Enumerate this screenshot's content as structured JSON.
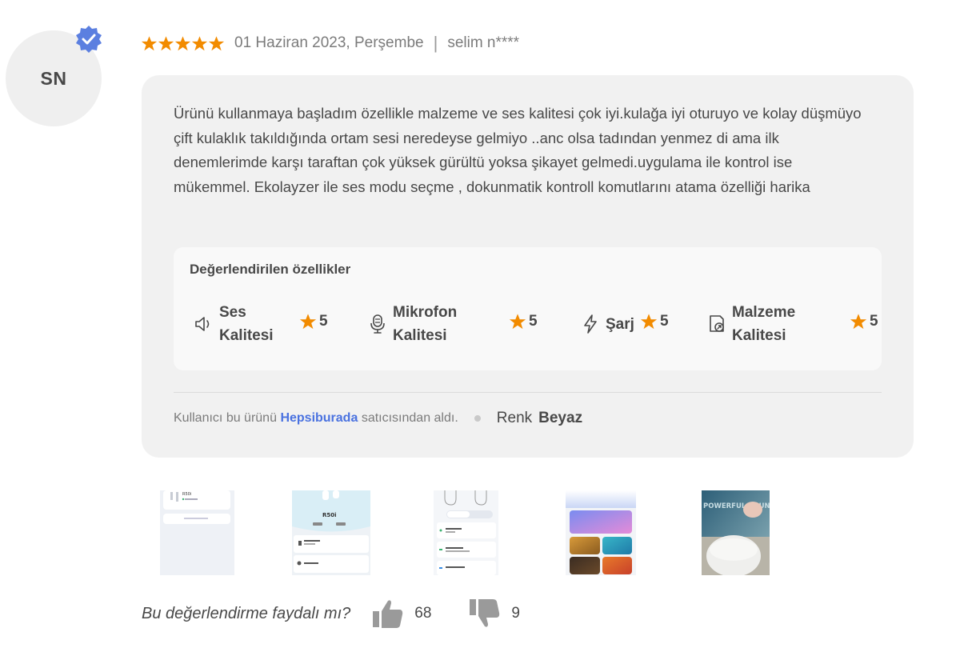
{
  "reviewer": {
    "initials": "SN",
    "name": "selim n****",
    "verified": true
  },
  "review": {
    "rating": 5,
    "date": "01 Haziran 2023, Perşembe",
    "separator": "|",
    "text": "Ürünü kullanmaya başladım özellikle malzeme ve ses kalitesi çok iyi.kulağa iyi oturuyo ve kolay düşmüyo çift kulaklık takıldığında ortam sesi neredeyse gelmiyo ..anc olsa tadından yenmez di ama ilk denemlerimde karşı taraftan çok yüksek gürültü yoksa şikayet gelmedi.uygulama ile kontrol ise mükemmel. Ekolayzer ile ses modu seçme , dokunmatik kontroll komutlarını atama özelliği harika"
  },
  "features": {
    "title": "Değerlendirilen özellikler",
    "items": [
      {
        "line1": "Ses",
        "line2": "Kalitesi",
        "score": "5",
        "icon": "speaker-icon"
      },
      {
        "line1": "Mikrofon",
        "line2": "Kalitesi",
        "score": "5",
        "icon": "microphone-icon"
      },
      {
        "line1": "Şarj",
        "line2": "",
        "score": "5",
        "icon": "lightning-icon"
      },
      {
        "line1": "Malzeme",
        "line2": "Kalitesi",
        "score": "5",
        "icon": "material-icon"
      }
    ]
  },
  "purchase": {
    "prefix": "Kullanıcı bu ürünü",
    "seller": "Hepsiburada",
    "suffix": "satıcısından aldı.",
    "color_label": "Renk",
    "color_value": "Beyaz"
  },
  "images": [
    {
      "kind": "app-screenshot-list",
      "caption": "R50i"
    },
    {
      "kind": "app-screenshot-device",
      "caption": "R50i"
    },
    {
      "kind": "app-screenshot-controls"
    },
    {
      "kind": "app-screenshot-eq"
    },
    {
      "kind": "product-photo",
      "caption": "POWERFUL SOUND"
    }
  ],
  "helpful": {
    "question": "Bu değerlendirme faydalı mı?",
    "up_count": "68",
    "down_count": "9"
  },
  "colors": {
    "star": "#f28b00",
    "badge": "#5b7fe0",
    "link": "#4a72e0",
    "panel": "#f1f1f1"
  }
}
